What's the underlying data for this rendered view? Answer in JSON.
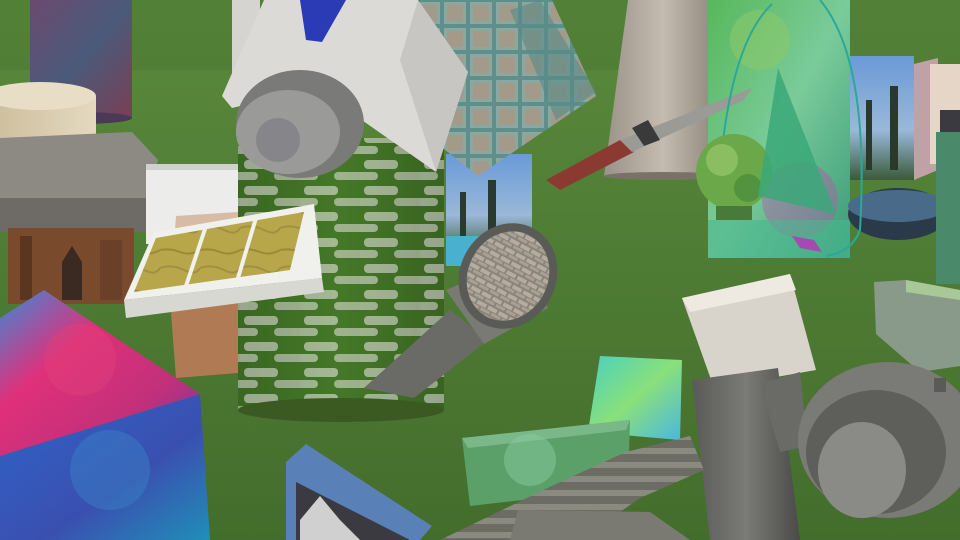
{
  "scene": {
    "kind": "rendered-3d-object-clutter",
    "palette": {
      "grass": "#4f7a36",
      "grass_dark": "#3f6a2a",
      "stone_gray": "#8a8a86",
      "moss_green": "#3f6e24",
      "mortar_white": "#c9c9c2",
      "plastic_white": "#dcdad6",
      "accent_blue": "#2b3bb5",
      "teal_fabric": "#5b8f8a",
      "wood_tan": "#d8cbb0",
      "solar_yellow": "#b8a64a",
      "magenta": "#e0307a",
      "cyan": "#48d0d0",
      "sky_blue": "#4a7fc0"
    },
    "objects": [
      "cylinder-purple-marble",
      "cylinder-wood",
      "slab-concrete",
      "box-church-wood",
      "panel-white",
      "crate-brown",
      "box-magenta-tiedye",
      "cylinder-mossy-stone",
      "satellite-white",
      "fabric-cube-teal",
      "solar-panel",
      "cone-concrete",
      "box-mountain-photo",
      "knife",
      "panel-tiedye-green",
      "sphere-tiedye",
      "box-lake-photo",
      "box-forest-photo",
      "pipe-cobblestone",
      "tile-tiedye-cyan",
      "block-tiedye-green",
      "block-mountain-photo",
      "box-tiedye-right",
      "box-white-top",
      "robot-gray",
      "hose-gray"
    ]
  }
}
